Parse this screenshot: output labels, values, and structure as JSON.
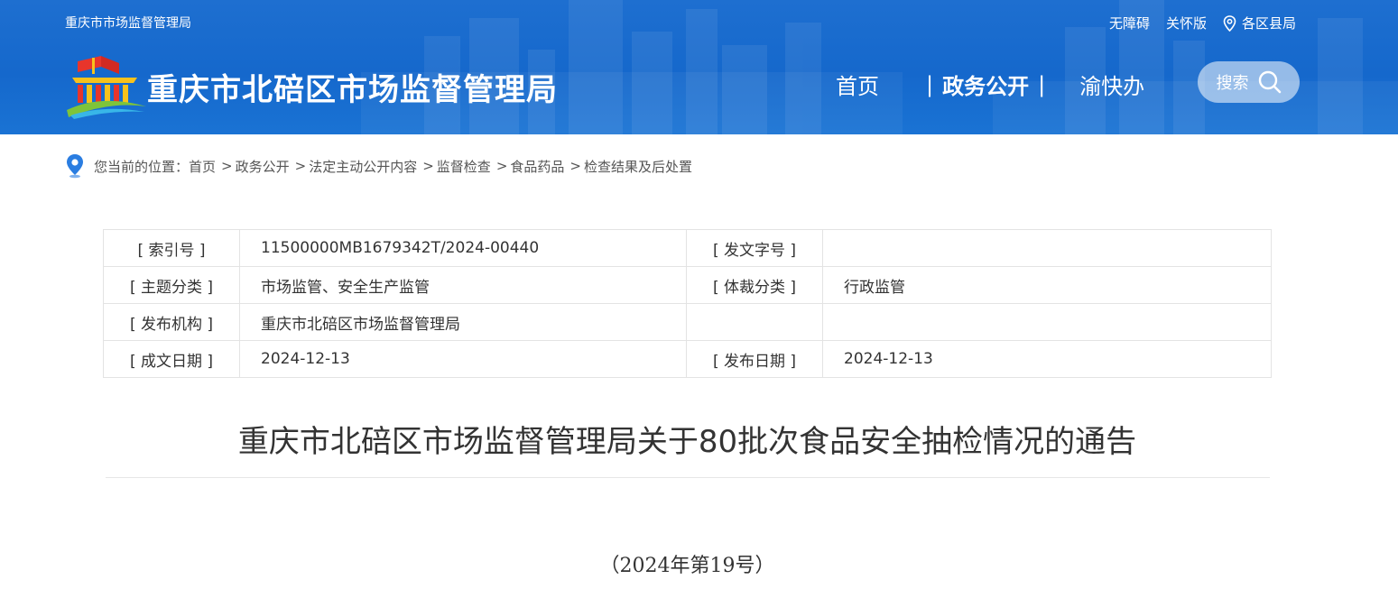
{
  "header": {
    "top_left": "重庆市市场监督管理局",
    "top_links": [
      "无障碍",
      "关怀版"
    ],
    "area_link": "各区县局",
    "site_title": "重庆市北碚区市场监督管理局",
    "nav": {
      "home": "首页",
      "separator": "|",
      "active": "政务公开",
      "yu": "渝快办"
    },
    "search_label": "搜索"
  },
  "breadcrumb": {
    "prefix": "您当前的位置：",
    "items": [
      "首页",
      "政务公开",
      "法定主动公开内容",
      "监督检查",
      "食品药品",
      "检查结果及后处置"
    ],
    "separator": ">"
  },
  "meta": {
    "rows": [
      {
        "label1": "[ 索引号 ]",
        "value1": "11500000MB1679342T/2024-00440",
        "label2": "[ 发文字号 ]",
        "value2": ""
      },
      {
        "label1": "[ 主题分类 ]",
        "value1": "市场监管、安全生产监管",
        "label2": "[ 体裁分类 ]",
        "value2": "行政监管"
      },
      {
        "label1": "[ 发布机构 ]",
        "value1": "重庆市北碚区市场监督管理局",
        "label2": "",
        "value2": ""
      },
      {
        "label1": "[ 成文日期 ]",
        "value1": "2024-12-13",
        "label2": "[ 发布日期 ]",
        "value2": "2024-12-13"
      }
    ]
  },
  "article": {
    "title": "重庆市北碚区市场监督管理局关于80批次食品安全抽检情况的通告",
    "doc_number": "（2024年第19号）"
  },
  "colors": {
    "header_blue": "#1568cc",
    "white": "#ffffff",
    "text": "#333333",
    "border": "#e3e3e3"
  },
  "icons": {
    "logo": "government-building-logo",
    "area": "location-pin-icon",
    "search": "search-icon",
    "breadcrumb": "location-marker-icon"
  }
}
